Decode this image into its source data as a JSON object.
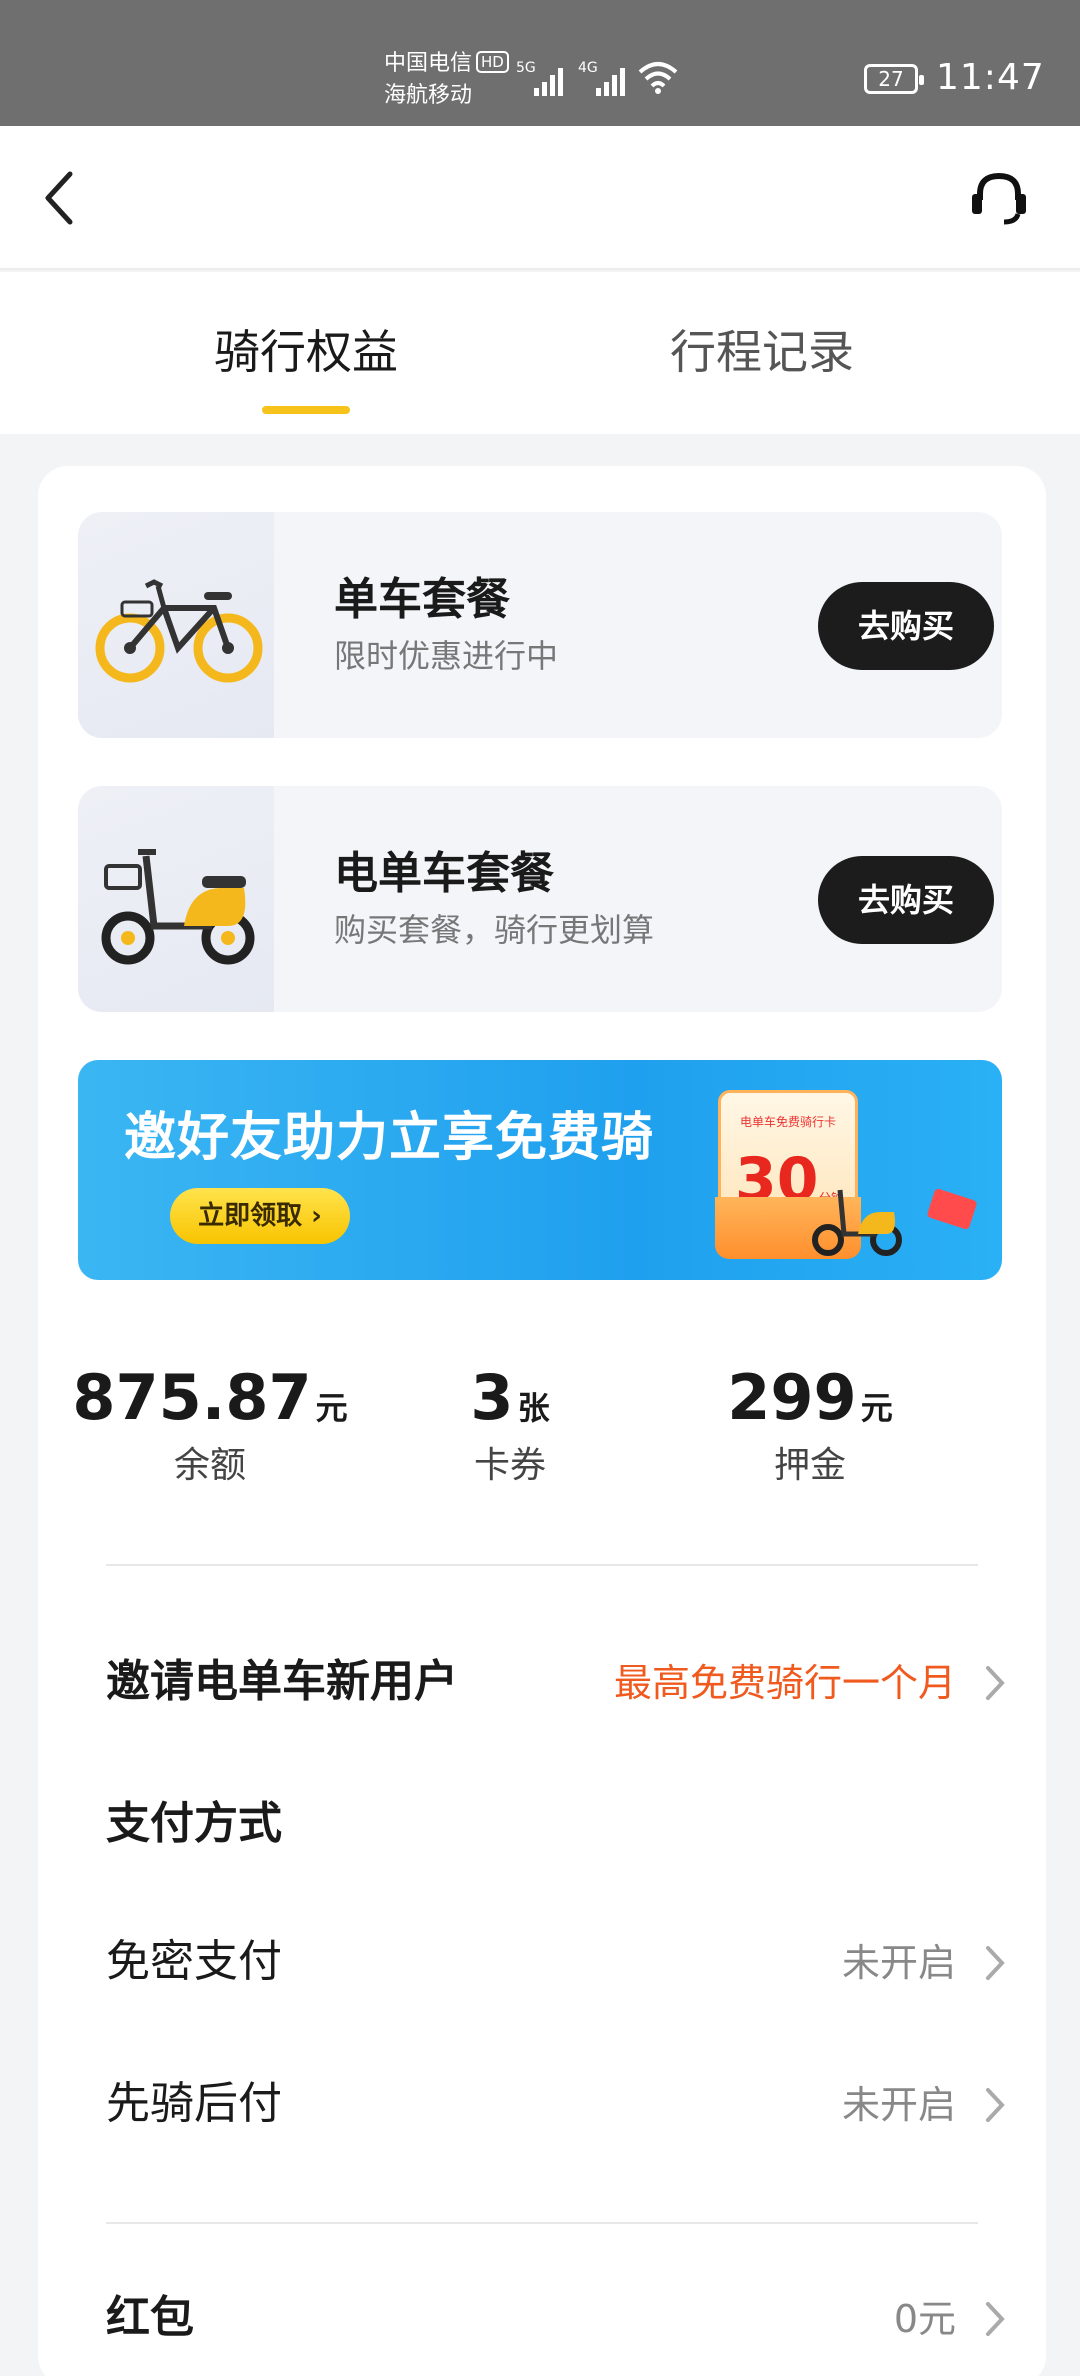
{
  "status_bar": {
    "carrier_1": "中国电信",
    "carrier_hd": "HD",
    "carrier_2": "海航移动",
    "network_1": "5G",
    "network_2": "4G",
    "battery": "27",
    "time": "11:47"
  },
  "tabs": [
    {
      "label": "骑行权益",
      "active": true
    },
    {
      "label": "行程记录",
      "active": false
    }
  ],
  "packages": [
    {
      "title": "单车套餐",
      "subtitle": "限时优惠进行中",
      "button": "去购买"
    },
    {
      "title": "电单车套餐",
      "subtitle": "购买套餐，骑行更划算",
      "button": "去购买"
    }
  ],
  "banner": {
    "title": "邀好友助力立享免费骑",
    "button": "立即领取 ›",
    "coupon_title": "电单车免费骑行卡",
    "coupon_value": "30",
    "coupon_unit": "分钟"
  },
  "stats": [
    {
      "value": "875.87",
      "unit": "元",
      "label": "余额"
    },
    {
      "value": "3",
      "unit": "张",
      "label": "卡券"
    },
    {
      "value": "299",
      "unit": "元",
      "label": "押金"
    }
  ],
  "rows": {
    "invite": {
      "label": "邀请电单车新用户",
      "value": "最高免费骑行一个月"
    },
    "payment_section": "支付方式",
    "password_free": {
      "label": "免密支付",
      "value": "未开启"
    },
    "ride_first": {
      "label": "先骑后付",
      "value": "未开启"
    },
    "red_packet": {
      "label": "红包",
      "value": "0元"
    }
  },
  "colors": {
    "accent_yellow": "#f7c21a",
    "button_dark": "#1c1c1c",
    "highlight_orange": "#f05a1e",
    "banner_blue": "#1fa0ee"
  }
}
